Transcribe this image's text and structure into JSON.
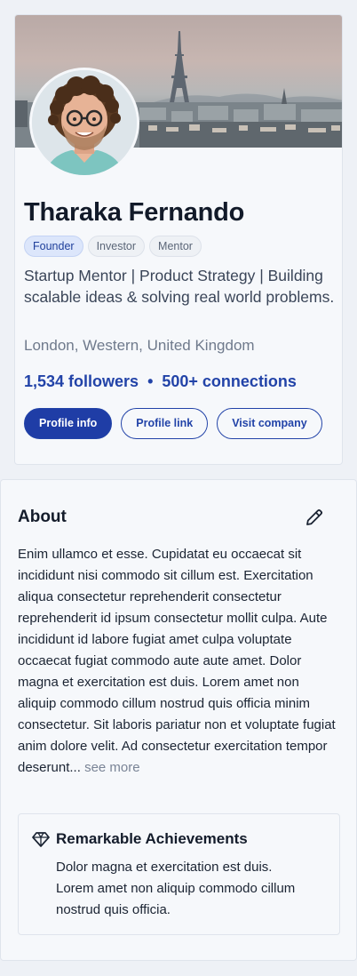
{
  "profile": {
    "name": "Tharaka Fernando",
    "tags": [
      "Founder",
      "Investor",
      "Mentor"
    ],
    "headline": "Startup Mentor | Product Strategy | Building scalable ideas & solving real world problems.",
    "location": "London, Western, United Kingdom",
    "followers": "1,534 followers",
    "separator": "•",
    "connections": "500+ connections",
    "buttons": {
      "profile_info": "Profile info",
      "profile_link": "Profile link",
      "visit_company": "Visit company"
    }
  },
  "about": {
    "title": "About",
    "text": "Enim ullamco et esse. Cupidatat eu occaecat sit incididunt nisi commodo sit cillum est. Exercitation aliqua consectetur reprehenderit consectetur reprehenderit id ipsum consectetur mollit culpa. Aute incididunt id labore fugiat amet culpa voluptate occaecat fugiat commodo aute aute amet. Dolor magna et exercitation est duis. Lorem amet non aliquip commodo cillum nostrud quis officia minim consectetur. Sit laboris pariatur non et voluptate fugiat anim dolore velit. Ad consectetur exercitation tempor deserunt...",
    "see_more": "see more",
    "achievement": {
      "title": "Remarkable Achievements",
      "text": "Dolor magna et exercitation est duis. Lorem amet non aliquip commodo cillum nostrud quis officia."
    }
  },
  "icons": {
    "edit": "pencil-icon",
    "achievement": "diamond-icon"
  },
  "colors": {
    "accent": "#1f3da6",
    "background": "#eef1f6",
    "card": "#f6f8fb",
    "active_tag_bg": "#dce6fb"
  }
}
